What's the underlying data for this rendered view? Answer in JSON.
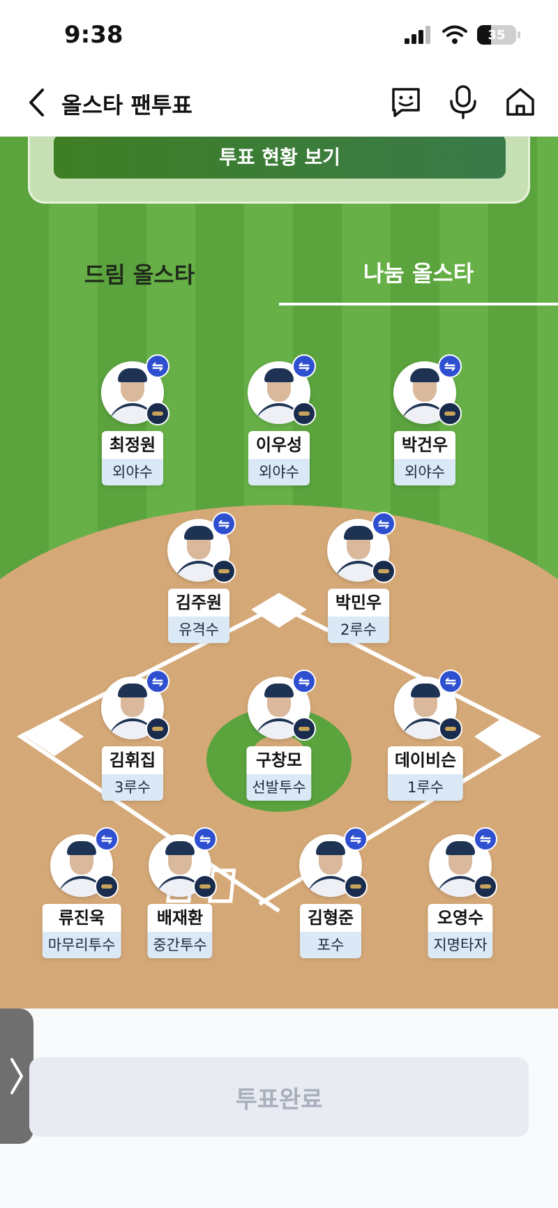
{
  "status_bar": {
    "time": "9:38",
    "battery": "35"
  },
  "header": {
    "title": "올스타 팬투표"
  },
  "vote_status": {
    "label": "투표 현황 보기"
  },
  "tabs": [
    {
      "label": "드림 올스타",
      "active": false
    },
    {
      "label": "나눔 올스타",
      "active": true
    }
  ],
  "players": [
    {
      "name": "최정원",
      "position": "외야수"
    },
    {
      "name": "이우성",
      "position": "외야수"
    },
    {
      "name": "박건우",
      "position": "외야수"
    },
    {
      "name": "김주원",
      "position": "유격수"
    },
    {
      "name": "박민우",
      "position": "2루수"
    },
    {
      "name": "김휘집",
      "position": "3루수"
    },
    {
      "name": "구창모",
      "position": "선발투수"
    },
    {
      "name": "데이비슨",
      "position": "1루수"
    },
    {
      "name": "류진욱",
      "position": "마무리투수"
    },
    {
      "name": "배재환",
      "position": "중간투수"
    },
    {
      "name": "김형준",
      "position": "포수"
    },
    {
      "name": "오영수",
      "position": "지명타자"
    }
  ],
  "swap_icon": "⇋",
  "footer": {
    "vote_complete_label": "투표완료"
  },
  "colors": {
    "accent_blue": "#2e4fd0",
    "field_green": "#5aa33d",
    "dirt": "#d5a877"
  }
}
